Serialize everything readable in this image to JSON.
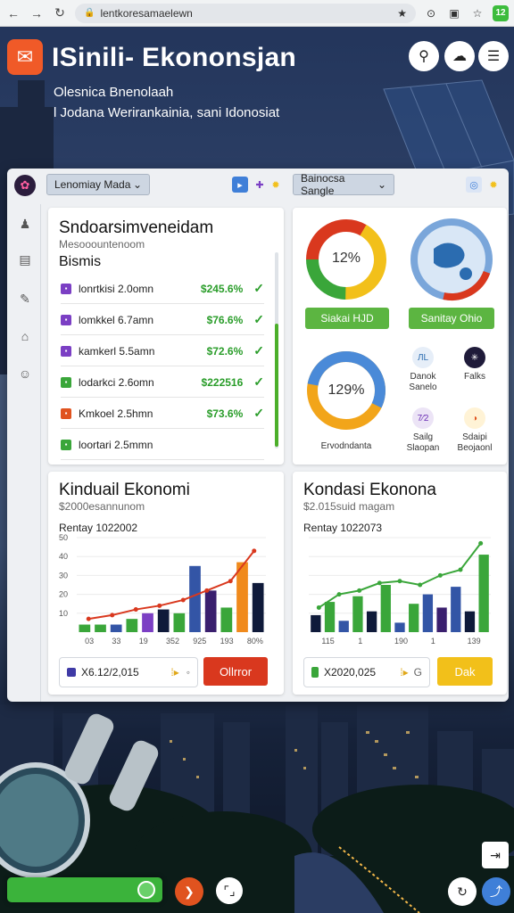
{
  "browser": {
    "url": "lentkoresamaelewn",
    "nav": {
      "back": "←",
      "forward": "→",
      "reload": "↻"
    }
  },
  "header": {
    "title": "ISinili- Ekononsjan",
    "subtitle1": "Olesnica Bnenolaah",
    "subtitle2": "l Jodana Werirankainia, sani Idonosiat"
  },
  "toolbar": {
    "left_select": "Lenomiay Mada",
    "right_select": "Bainocsa Sangle"
  },
  "list_card": {
    "title": "Sndoarsimveneidam",
    "subtitle": "Mesooountenoom",
    "section": "Bismis",
    "rows": [
      {
        "name": "lonrtkisi 2.0omn",
        "value": "$245.6%",
        "icon_color": "#7b3fc4"
      },
      {
        "name": "lomkkel 6.7amn",
        "value": "$76.6%",
        "icon_color": "#7b3fc4"
      },
      {
        "name": "kamkerl 5.5amn",
        "value": "$72.6%",
        "icon_color": "#7b3fc4"
      },
      {
        "name": "lodarkci 2.6omn",
        "value": "$222516",
        "icon_color": "#3aa63a"
      },
      {
        "name": "Kmkoel 2.5hmn",
        "value": "$73.6%",
        "icon_color": "#e0531f"
      },
      {
        "name": "loortari 2.5mmn",
        "value": "",
        "icon_color": "#3aa63a"
      }
    ]
  },
  "donut_card": {
    "donut1": {
      "label": "12%",
      "button": "Siakai HJD"
    },
    "donut2": {
      "button": "Sanitay Ohio"
    },
    "donut3": {
      "label": "129%",
      "caption": "Ervodndanta"
    },
    "minis": [
      {
        "label": "Danok Sanelo",
        "glyph": "ЛL",
        "bg": "#e6eef8",
        "fg": "#2b6cb0"
      },
      {
        "label": "Falks",
        "glyph": "✳",
        "bg": "#1f1b3a",
        "fg": "#fff"
      },
      {
        "label": "Sailg Slaopan",
        "glyph": "7⁄2",
        "bg": "#ece4f6",
        "fg": "#6b2fb5"
      },
      {
        "label": "Sdaipi Beojaonl",
        "glyph": "◑",
        "bg": "#fff3d6",
        "fg": "#e0531f"
      }
    ]
  },
  "chart_card_left": {
    "title": "Kinduail Ekonomi",
    "subtitle": "$2000esannunom",
    "chart_title": "Rentay 1022002",
    "footer_value": "X6.12/2,015",
    "cta": "Ollrror",
    "colors": {
      "cta": "#d9381e"
    }
  },
  "chart_card_right": {
    "title": "Kondasi Ekonona",
    "subtitle": "$2.015suid magam",
    "chart_title": "Rentay 1022073",
    "footer_value": "X2020,025",
    "cta": "Dak",
    "colors": {
      "cta": "#f2c01a"
    }
  },
  "chart_data": [
    {
      "type": "bar",
      "title": "Rentay 1022002",
      "ylim": [
        0,
        50
      ],
      "yticks": [
        "10",
        "20",
        "30",
        "40",
        "50"
      ],
      "xticks": [
        "03",
        "33",
        "19",
        "352",
        "925",
        "193",
        "80%"
      ],
      "values": [
        4,
        4,
        4,
        7,
        10,
        12,
        10,
        35,
        22,
        13,
        37,
        26
      ],
      "colors": [
        "#3aa63a",
        "#3aa63a",
        "#3355a6",
        "#3aa63a",
        "#7b3fc4",
        "#0f1a3a",
        "#3aa63a",
        "#3355a6",
        "#3a1f6e",
        "#3aa63a",
        "#f08a1c",
        "#0f1a3a",
        "#3aa63a"
      ],
      "line": [
        7,
        9,
        12,
        14,
        17,
        22,
        27,
        43
      ]
    },
    {
      "type": "bar",
      "title": "Rentay 1022073",
      "ylim": [
        0,
        50
      ],
      "yticks": [
        "10",
        "20",
        "30",
        "40",
        "50"
      ],
      "xticks": [
        "115",
        "1",
        "190",
        "1",
        "139"
      ],
      "values": [
        9,
        16,
        6,
        19,
        11,
        25,
        5,
        15,
        20,
        13,
        24,
        11,
        41
      ],
      "colors": [
        "#0f1a3a",
        "#3aa63a",
        "#3355a6",
        "#3aa63a",
        "#0f1a3a",
        "#3aa63a",
        "#3355a6",
        "#3aa63a",
        "#3355a6",
        "#3a1f6e",
        "#3355a6",
        "#0f1a3a",
        "#3aa63a"
      ],
      "line": [
        13,
        20,
        22,
        26,
        27,
        25,
        30,
        33,
        47
      ]
    }
  ]
}
